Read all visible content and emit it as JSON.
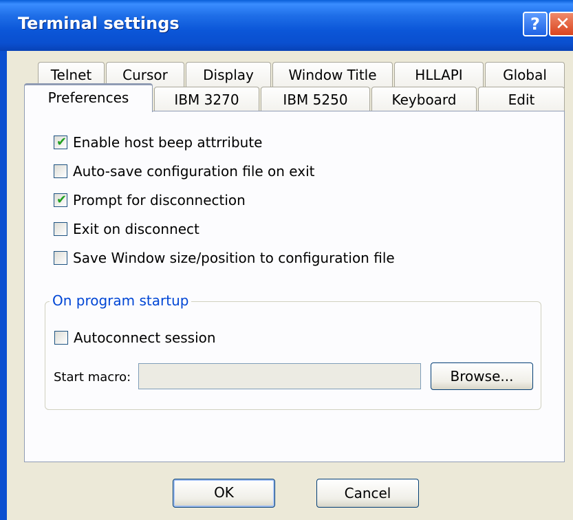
{
  "window": {
    "title": "Terminal settings",
    "help_glyph": "?",
    "close_glyph": "✕"
  },
  "tabs": {
    "row_back": [
      {
        "label": "Telnet"
      },
      {
        "label": "Cursor"
      },
      {
        "label": "Display"
      },
      {
        "label": "Window Title"
      },
      {
        "label": "HLLAPI"
      },
      {
        "label": "Global"
      }
    ],
    "row_front": [
      {
        "label": "Preferences",
        "active": true
      },
      {
        "label": "IBM 3270"
      },
      {
        "label": "IBM 5250"
      },
      {
        "label": "Keyboard"
      },
      {
        "label": "Edit"
      }
    ]
  },
  "preferences": {
    "options": [
      {
        "label": "Enable host beep attrribute",
        "checked": true
      },
      {
        "label": "Auto-save configuration file on exit",
        "checked": false
      },
      {
        "label": "Prompt for disconnection",
        "checked": true
      },
      {
        "label": "Exit on disconnect",
        "checked": false
      },
      {
        "label": "Save Window size/position to configuration file",
        "checked": false
      }
    ],
    "startup_group": {
      "label": "On program startup",
      "autoconnect": {
        "label": "Autoconnect session",
        "checked": false
      },
      "start_macro_label": "Start macro:",
      "start_macro_value": "",
      "browse_label": "Browse..."
    }
  },
  "buttons": {
    "ok": "OK",
    "cancel": "Cancel"
  },
  "colors": {
    "titlebar": "#0a56d8",
    "active_tab_accent": "#f5b53d",
    "group_label": "#0046d5",
    "check": "#21a121"
  },
  "icons": {
    "help": "help-icon",
    "close": "close-icon",
    "check": "checkmark-icon"
  }
}
